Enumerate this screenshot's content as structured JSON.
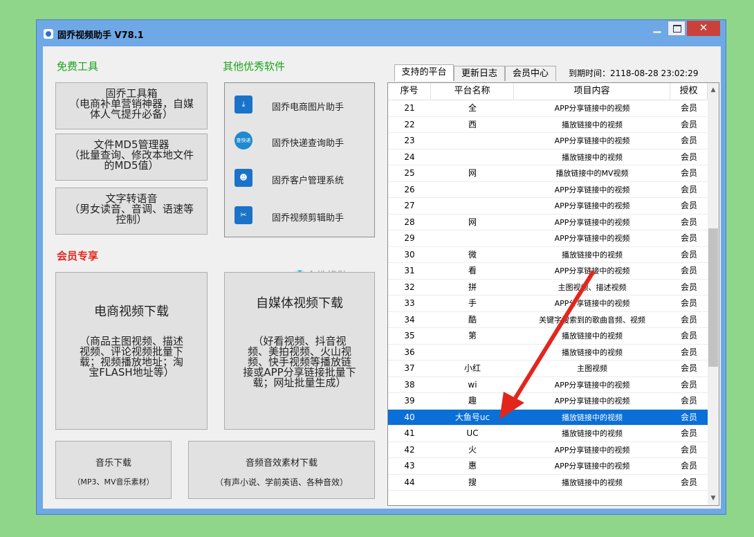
{
  "window": {
    "title": "固乔视频助手 V78.1"
  },
  "left": {
    "free_tools_label": "免费工具",
    "other_software_label": "其他优秀软件",
    "member_label": "会员专享",
    "skin_label": "个性换肤",
    "tools": [
      {
        "text": "固乔工具箱\n（电商补单营销神器，自媒\n体人气提升必备）"
      },
      {
        "text": "文件MD5管理器\n（批量查询、修改本地文件\n的MD5值）"
      },
      {
        "text": "文字转语音\n（男女读音、音调、语速等\n控制）"
      }
    ],
    "software": [
      {
        "label": "固乔电商图片助手",
        "icon": "download-icon"
      },
      {
        "label": "固乔快递查询助手",
        "icon": "express-search-icon"
      },
      {
        "label": "固乔客户管理系统",
        "icon": "contacts-icon"
      },
      {
        "label": "固乔视频剪辑助手",
        "icon": "scissors-icon"
      }
    ],
    "ecommerce_video": {
      "title": "电商视频下载",
      "desc": "（商品主图视频、描述\n视频、评论视频批量下\n载；视频播放地址；淘\n宝FLASH地址等）"
    },
    "media_video": {
      "title": "自媒体视频下载",
      "desc": "（好看视频、抖音视\n频、美拍视频、火山视\n频、快手视频等播放链\n接或APP分享链接批量下\n载；网址批量生成）"
    },
    "music": {
      "title": "音乐下载",
      "desc": "（MP3、MV音乐素材）"
    },
    "audio": {
      "title": "音频音效素材下载",
      "desc": "（有声小说、学前英语、各种音效）"
    }
  },
  "tabs": [
    "支持的平台",
    "更新日志",
    "会员中心"
  ],
  "expire": "到期时间：2118-08-28 23:02:29",
  "table": {
    "headers": [
      "序号",
      "平台名称",
      "项目内容",
      "授权"
    ],
    "rows": [
      [
        "21",
        "全",
        "APP分享链接中的视频",
        "会员"
      ],
      [
        "22",
        "西",
        "播放链接中的视频",
        "会员"
      ],
      [
        "23",
        "",
        "APP分享链接中的视频",
        "会员"
      ],
      [
        "24",
        "",
        "播放链接中的视频",
        "会员"
      ],
      [
        "25",
        "网",
        "播放链接中的MV视频",
        "会员"
      ],
      [
        "26",
        "",
        "APP分享链接中的视频",
        "会员"
      ],
      [
        "27",
        "",
        "APP分享链接中的视频",
        "会员"
      ],
      [
        "28",
        "网",
        "APP分享链接中的视频",
        "会员"
      ],
      [
        "29",
        "",
        "APP分享链接中的视频",
        "会员"
      ],
      [
        "30",
        "微",
        "播放链接中的视频",
        "会员"
      ],
      [
        "31",
        "看",
        "APP分享链接中的视频",
        "会员"
      ],
      [
        "32",
        "拼",
        "主图视频、描述视频",
        "会员"
      ],
      [
        "33",
        "手",
        "APP分享链接中的视频",
        "会员"
      ],
      [
        "34",
        "酷",
        "关键字搜索到的歌曲音频、视频",
        "会员"
      ],
      [
        "35",
        "第",
        "播放链接中的视频",
        "会员"
      ],
      [
        "36",
        "",
        "播放链接中的视频",
        "会员"
      ],
      [
        "37",
        "小红",
        "主图视频",
        "会员"
      ],
      [
        "38",
        "wi",
        "APP分享链接中的视频",
        "会员"
      ],
      [
        "39",
        "趣",
        "APP分享链接中的视频",
        "会员"
      ],
      [
        "40",
        "大鱼号uc",
        "播放链接中的视频",
        "会员"
      ],
      [
        "41",
        "UC",
        "播放链接中的视频",
        "会员"
      ],
      [
        "42",
        "火",
        "APP分享链接中的视频",
        "会员"
      ],
      [
        "43",
        "惠",
        "APP分享链接中的视频",
        "会员"
      ],
      [
        "44",
        "搜",
        "播放链接中的视频",
        "会员"
      ]
    ],
    "selected_index": 19
  },
  "colors": {
    "accent": "#0a6fd6",
    "arrow": "#e3261b"
  }
}
